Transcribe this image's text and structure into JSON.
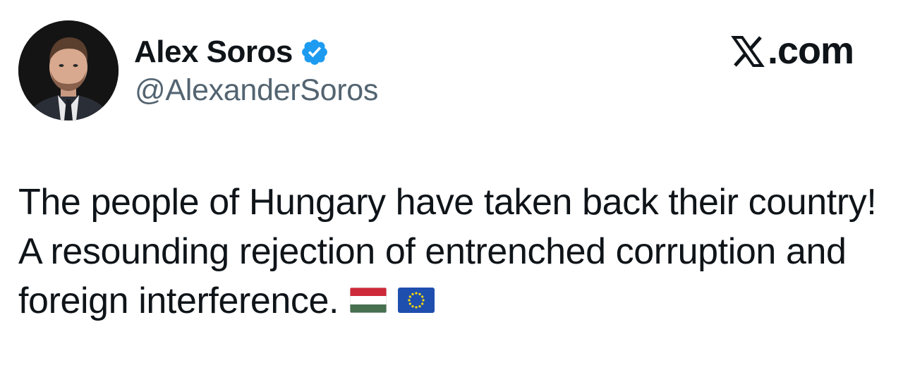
{
  "author": {
    "display_name": "Alex Soros",
    "handle": "@AlexanderSoros",
    "verified": true
  },
  "brand": {
    "label": ".com",
    "icon": "x-logo-icon"
  },
  "tweet": {
    "text": "The people of Hungary have taken back their country! A resounding rejection of entrenched corruption and foreign interference.",
    "emoji": [
      "hungary-flag-icon",
      "eu-flag-icon"
    ]
  },
  "colors": {
    "verified_badge": "#1d9bf0",
    "handle": "#536471",
    "text": "#0f1419"
  }
}
